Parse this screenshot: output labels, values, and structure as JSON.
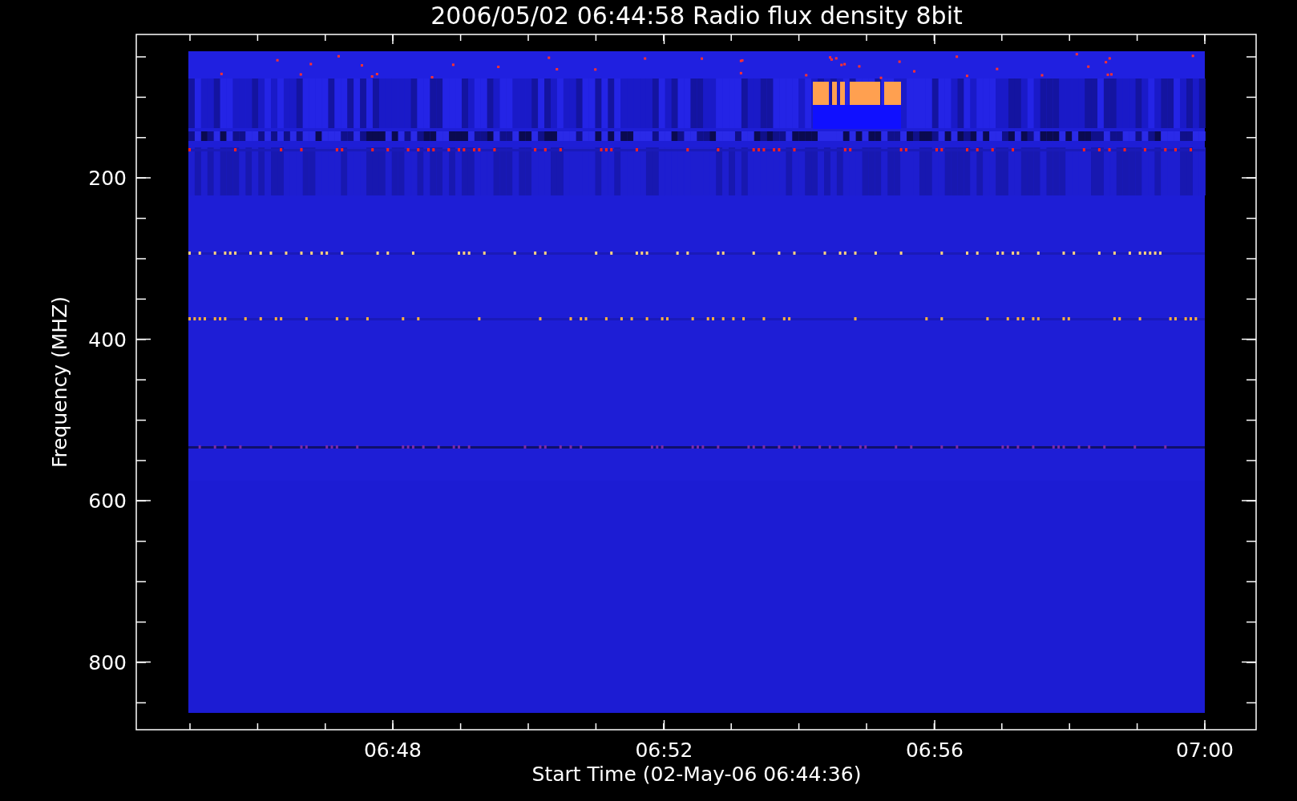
{
  "title": "2006/05/02 06:44:58 Radio flux density 8bit",
  "y_axis": {
    "label": "Frequency (MHZ)",
    "ticks": [
      "200",
      "400",
      "600",
      "800"
    ]
  },
  "x_axis": {
    "label": "Start Time (02-May-06 06:44:36)",
    "ticks": [
      "06:48",
      "06:52",
      "06:56",
      "07:00"
    ]
  }
}
